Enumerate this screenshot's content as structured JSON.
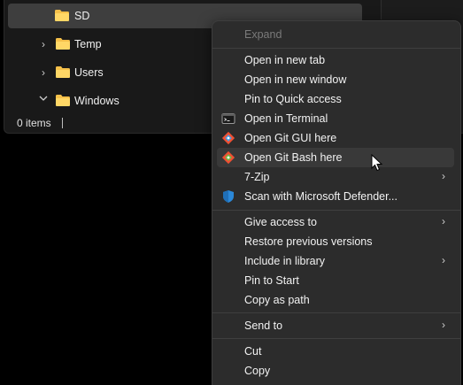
{
  "tree": {
    "items": [
      {
        "label": "SD",
        "state": "selected"
      },
      {
        "label": "Temp",
        "state": "collapsed"
      },
      {
        "label": "Users",
        "state": "collapsed"
      },
      {
        "label": "Windows",
        "state": "expanded"
      }
    ],
    "chevron_right": "›",
    "chevron_down": "⌄"
  },
  "status": {
    "items_count": "0 items"
  },
  "menu": {
    "expand": "Expand",
    "open_new_tab": "Open in new tab",
    "open_new_window": "Open in new window",
    "pin_quick_access": "Pin to Quick access",
    "open_terminal": "Open in Terminal",
    "open_git_gui": "Open Git GUI here",
    "open_git_bash": "Open Git Bash here",
    "seven_zip": "7-Zip",
    "scan_defender": "Scan with Microsoft Defender...",
    "give_access": "Give access to",
    "restore_versions": "Restore previous versions",
    "include_library": "Include in library",
    "pin_start": "Pin to Start",
    "copy_as_path": "Copy as path",
    "send_to": "Send to",
    "cut": "Cut",
    "copy": "Copy",
    "submenu_arrow": "›"
  },
  "colors": {
    "folder": "#f5c04a",
    "menu_bg": "#2c2c2c",
    "hover_bg": "#393939",
    "git": "#f05033",
    "defender": "#2b88d8"
  }
}
